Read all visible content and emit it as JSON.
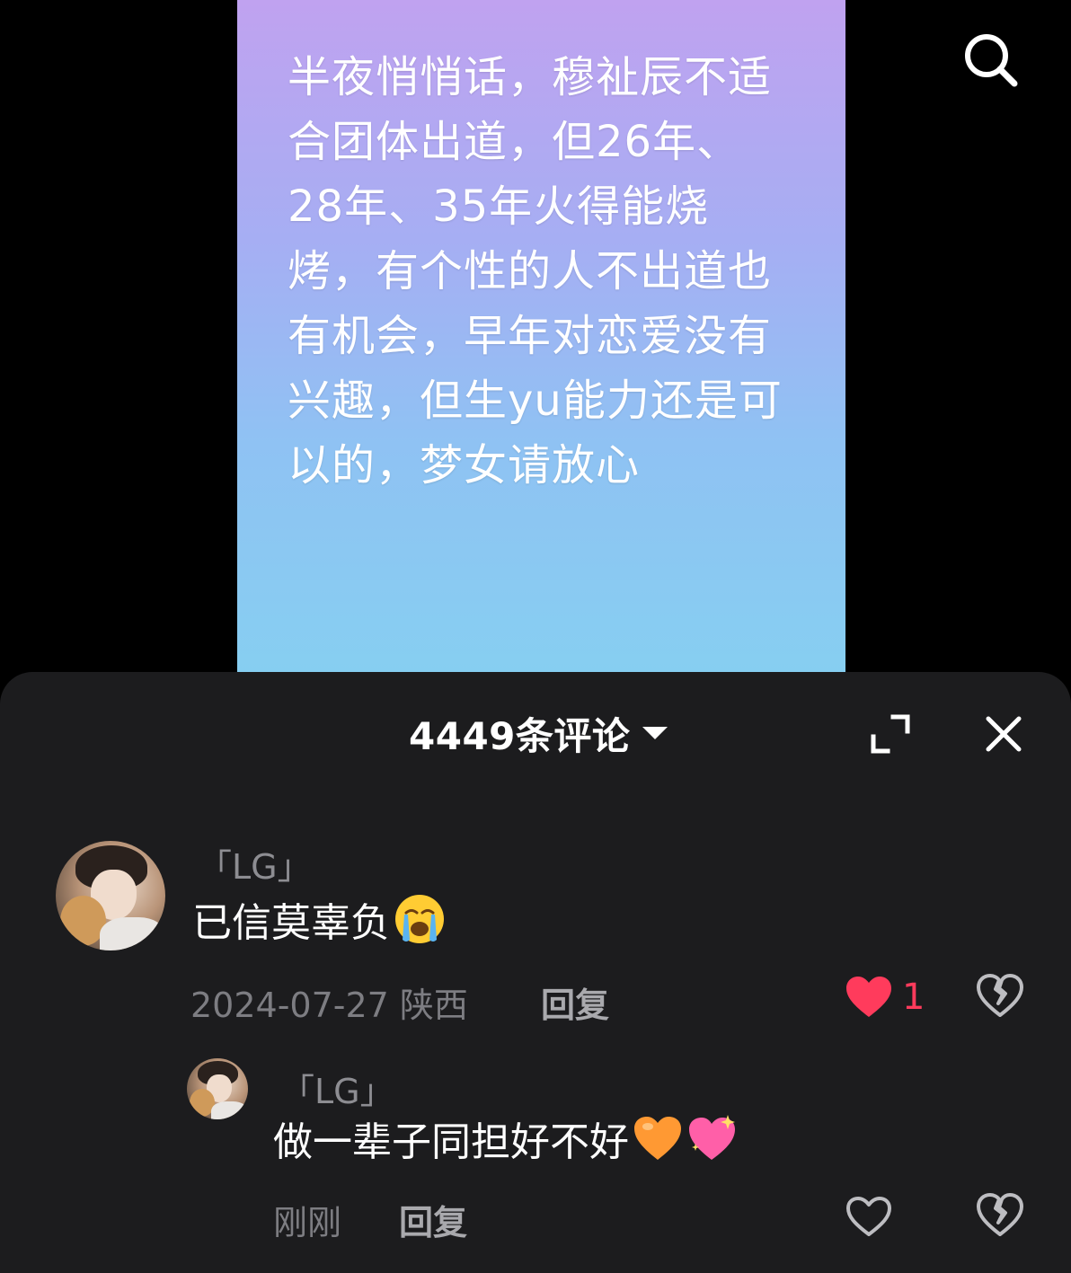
{
  "post": {
    "lines": [
      "半夜悄悄话，穆祉辰不适",
      "合团体出道，但26年、",
      "28年、35年火得能烧",
      "烤，有个性的人不出道也",
      "有机会，早年对恋爱没有",
      "兴趣，但生yu能力还是可",
      "以的，梦女请放心"
    ],
    "gradient_colors": [
      "#c0a2f0",
      "#a6aef3",
      "#8fc2f3",
      "#86cff1"
    ]
  },
  "top_bar": {
    "search_icon": "search-icon"
  },
  "comments_panel": {
    "count_label": "4449条评论",
    "caret_icon": "caret-down-icon",
    "expand_icon": "expand-icon",
    "close_icon": "close-icon",
    "comments": [
      {
        "username": "「LG」",
        "text": "已信莫辜负",
        "emoji": "loudly-crying-face",
        "date": "2024-07-27 陕西",
        "reply_label": "回复",
        "likes": "1",
        "liked": true,
        "replies": [
          {
            "username": "「LG」",
            "text": "做一辈子同担好不好",
            "emojis": [
              "orange-heart",
              "sparkling-heart"
            ],
            "date": "刚刚",
            "reply_label": "回复",
            "liked": false
          }
        ]
      }
    ]
  },
  "colors": {
    "panel_bg": "#1c1c1e",
    "like_red": "#ff3b5c",
    "muted_text": "#8d8d92"
  }
}
